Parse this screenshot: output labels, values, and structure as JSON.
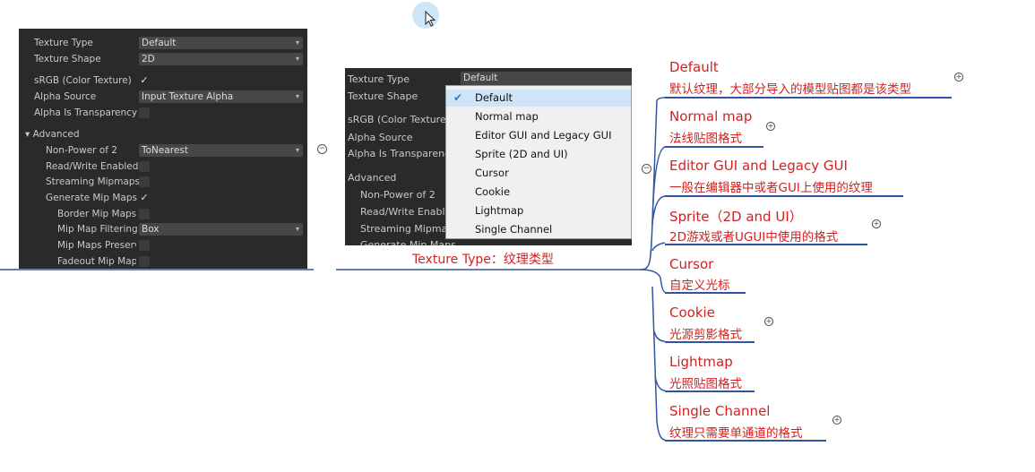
{
  "inspector_left": {
    "texture_type": {
      "label": "Texture Type",
      "value": "Default"
    },
    "texture_shape": {
      "label": "Texture Shape",
      "value": "2D"
    },
    "srgb": {
      "label": "sRGB (Color Texture)",
      "checked": true
    },
    "alpha_source": {
      "label": "Alpha Source",
      "value": "Input Texture Alpha"
    },
    "alpha_is_transparency": {
      "label": "Alpha Is Transparency",
      "checked": false
    },
    "advanced": {
      "label": "Advanced"
    },
    "non_power_of_2": {
      "label": "Non-Power of 2",
      "value": "ToNearest"
    },
    "read_write": {
      "label": "Read/Write Enabled",
      "checked": false
    },
    "streaming_mipmaps": {
      "label": "Streaming Mipmaps",
      "checked": false
    },
    "generate_mip_maps": {
      "label": "Generate Mip Maps",
      "checked": true
    },
    "border_mip_maps": {
      "label": "Border Mip Maps",
      "checked": false
    },
    "mip_map_filtering": {
      "label": "Mip Map Filtering",
      "value": "Box"
    },
    "mip_maps_preserve": {
      "label": "Mip Maps Preserv",
      "checked": false
    },
    "fadeout_mip_maps": {
      "label": "Fadeout Mip Maps",
      "checked": false
    },
    "check_glyph": "✓",
    "dropdown_glyph": "▾",
    "foldout_glyph": "▾"
  },
  "inspector_middle": {
    "texture_type": {
      "label": "Texture Type",
      "value": "Default"
    },
    "texture_shape": {
      "label": "Texture Shape"
    },
    "srgb": {
      "label": "sRGB (Color Texture"
    },
    "alpha_source": {
      "label": "Alpha Source"
    },
    "alpha_is_transparency": {
      "label": "Alpha Is Transparenc"
    },
    "advanced": {
      "label": "Advanced"
    },
    "non_power_of_2": {
      "label": "Non-Power of 2"
    },
    "read_write": {
      "label": "Read/Write Enable"
    },
    "streaming_mipmaps": {
      "label": "Streaming Mipmap"
    },
    "generate_mip_maps": {
      "label": "Generate Mip Maps"
    }
  },
  "dropdown": {
    "selected_index": 0,
    "items": [
      "Default",
      "Normal map",
      "Editor GUI and Legacy GUI",
      "Sprite (2D and UI)",
      "Cursor",
      "Cookie",
      "Lightmap",
      "Single Channel"
    ]
  },
  "mindmap": {
    "central": "Texture Type：纹理类型",
    "collapse_glyph": "−",
    "expand_glyph": "+",
    "line_color": "#2f55a3",
    "text_color": "#d02222",
    "nodes": [
      {
        "title": "Default",
        "desc": "默认纹理，大部分导入的模型贴图都是该类型"
      },
      {
        "title": "Normal map",
        "desc": "法线贴图格式"
      },
      {
        "title": "Editor GUI and Legacy GUI",
        "desc": "一般在编辑器中或者GUI上使用的纹理"
      },
      {
        "title": "Sprite（2D and UI）",
        "desc": "2D游戏或者UGUI中使用的格式"
      },
      {
        "title": "Cursor",
        "desc": "自定义光标"
      },
      {
        "title": "Cookie",
        "desc": "光源剪影格式"
      },
      {
        "title": "Lightmap",
        "desc": "光照贴图格式"
      },
      {
        "title": "Single Channel",
        "desc": "纹理只需要单通道的格式"
      }
    ]
  }
}
